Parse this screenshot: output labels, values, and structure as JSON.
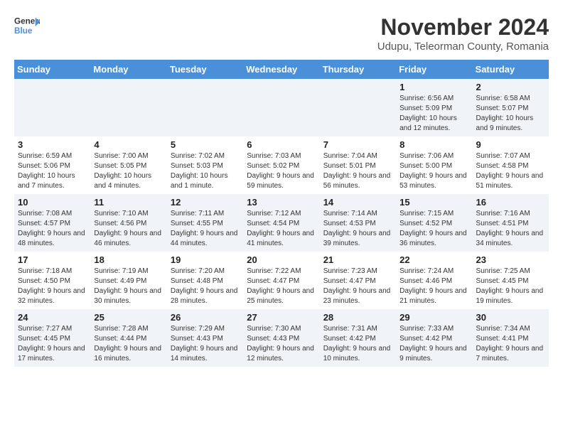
{
  "header": {
    "logo_line1": "General",
    "logo_line2": "Blue",
    "month": "November 2024",
    "location": "Udupu, Teleorman County, Romania"
  },
  "days_of_week": [
    "Sunday",
    "Monday",
    "Tuesday",
    "Wednesday",
    "Thursday",
    "Friday",
    "Saturday"
  ],
  "weeks": [
    [
      {
        "day": "",
        "info": ""
      },
      {
        "day": "",
        "info": ""
      },
      {
        "day": "",
        "info": ""
      },
      {
        "day": "",
        "info": ""
      },
      {
        "day": "",
        "info": ""
      },
      {
        "day": "1",
        "info": "Sunrise: 6:56 AM\nSunset: 5:09 PM\nDaylight: 10 hours and 12 minutes."
      },
      {
        "day": "2",
        "info": "Sunrise: 6:58 AM\nSunset: 5:07 PM\nDaylight: 10 hours and 9 minutes."
      }
    ],
    [
      {
        "day": "3",
        "info": "Sunrise: 6:59 AM\nSunset: 5:06 PM\nDaylight: 10 hours and 7 minutes."
      },
      {
        "day": "4",
        "info": "Sunrise: 7:00 AM\nSunset: 5:05 PM\nDaylight: 10 hours and 4 minutes."
      },
      {
        "day": "5",
        "info": "Sunrise: 7:02 AM\nSunset: 5:03 PM\nDaylight: 10 hours and 1 minute."
      },
      {
        "day": "6",
        "info": "Sunrise: 7:03 AM\nSunset: 5:02 PM\nDaylight: 9 hours and 59 minutes."
      },
      {
        "day": "7",
        "info": "Sunrise: 7:04 AM\nSunset: 5:01 PM\nDaylight: 9 hours and 56 minutes."
      },
      {
        "day": "8",
        "info": "Sunrise: 7:06 AM\nSunset: 5:00 PM\nDaylight: 9 hours and 53 minutes."
      },
      {
        "day": "9",
        "info": "Sunrise: 7:07 AM\nSunset: 4:58 PM\nDaylight: 9 hours and 51 minutes."
      }
    ],
    [
      {
        "day": "10",
        "info": "Sunrise: 7:08 AM\nSunset: 4:57 PM\nDaylight: 9 hours and 48 minutes."
      },
      {
        "day": "11",
        "info": "Sunrise: 7:10 AM\nSunset: 4:56 PM\nDaylight: 9 hours and 46 minutes."
      },
      {
        "day": "12",
        "info": "Sunrise: 7:11 AM\nSunset: 4:55 PM\nDaylight: 9 hours and 44 minutes."
      },
      {
        "day": "13",
        "info": "Sunrise: 7:12 AM\nSunset: 4:54 PM\nDaylight: 9 hours and 41 minutes."
      },
      {
        "day": "14",
        "info": "Sunrise: 7:14 AM\nSunset: 4:53 PM\nDaylight: 9 hours and 39 minutes."
      },
      {
        "day": "15",
        "info": "Sunrise: 7:15 AM\nSunset: 4:52 PM\nDaylight: 9 hours and 36 minutes."
      },
      {
        "day": "16",
        "info": "Sunrise: 7:16 AM\nSunset: 4:51 PM\nDaylight: 9 hours and 34 minutes."
      }
    ],
    [
      {
        "day": "17",
        "info": "Sunrise: 7:18 AM\nSunset: 4:50 PM\nDaylight: 9 hours and 32 minutes."
      },
      {
        "day": "18",
        "info": "Sunrise: 7:19 AM\nSunset: 4:49 PM\nDaylight: 9 hours and 30 minutes."
      },
      {
        "day": "19",
        "info": "Sunrise: 7:20 AM\nSunset: 4:48 PM\nDaylight: 9 hours and 28 minutes."
      },
      {
        "day": "20",
        "info": "Sunrise: 7:22 AM\nSunset: 4:47 PM\nDaylight: 9 hours and 25 minutes."
      },
      {
        "day": "21",
        "info": "Sunrise: 7:23 AM\nSunset: 4:47 PM\nDaylight: 9 hours and 23 minutes."
      },
      {
        "day": "22",
        "info": "Sunrise: 7:24 AM\nSunset: 4:46 PM\nDaylight: 9 hours and 21 minutes."
      },
      {
        "day": "23",
        "info": "Sunrise: 7:25 AM\nSunset: 4:45 PM\nDaylight: 9 hours and 19 minutes."
      }
    ],
    [
      {
        "day": "24",
        "info": "Sunrise: 7:27 AM\nSunset: 4:45 PM\nDaylight: 9 hours and 17 minutes."
      },
      {
        "day": "25",
        "info": "Sunrise: 7:28 AM\nSunset: 4:44 PM\nDaylight: 9 hours and 16 minutes."
      },
      {
        "day": "26",
        "info": "Sunrise: 7:29 AM\nSunset: 4:43 PM\nDaylight: 9 hours and 14 minutes."
      },
      {
        "day": "27",
        "info": "Sunrise: 7:30 AM\nSunset: 4:43 PM\nDaylight: 9 hours and 12 minutes."
      },
      {
        "day": "28",
        "info": "Sunrise: 7:31 AM\nSunset: 4:42 PM\nDaylight: 9 hours and 10 minutes."
      },
      {
        "day": "29",
        "info": "Sunrise: 7:33 AM\nSunset: 4:42 PM\nDaylight: 9 hours and 9 minutes."
      },
      {
        "day": "30",
        "info": "Sunrise: 7:34 AM\nSunset: 4:41 PM\nDaylight: 9 hours and 7 minutes."
      }
    ]
  ]
}
